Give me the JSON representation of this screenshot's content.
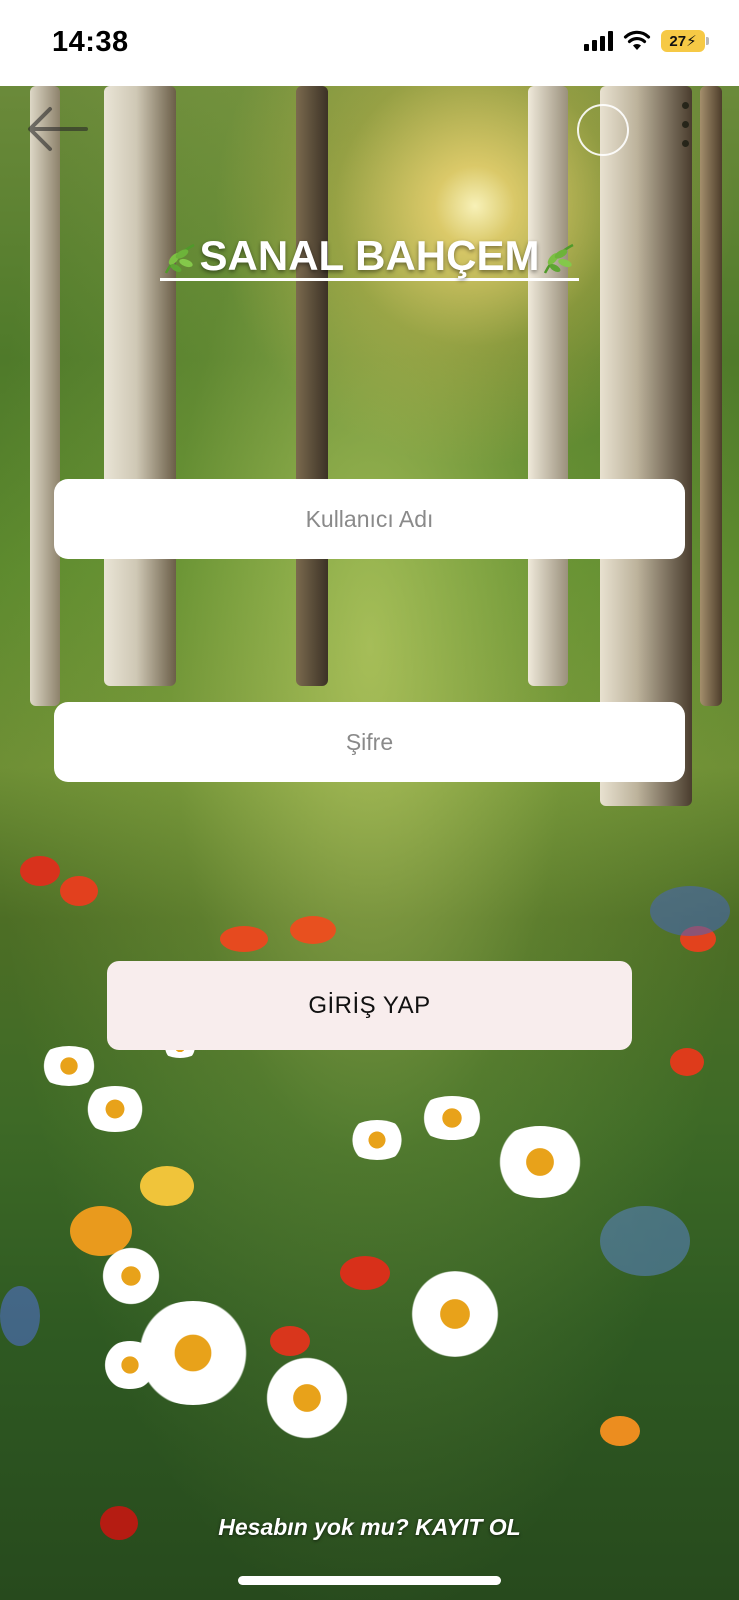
{
  "status_bar": {
    "time": "14:38",
    "battery": "27",
    "icons": [
      "signal-icon",
      "wifi-icon",
      "battery-charging-icon"
    ]
  },
  "nav": {
    "back_icon": "back-arrow-icon",
    "circle_icon": "circle-icon",
    "more_icon": "more-dots-icon"
  },
  "title": "SANAL BAHÇEM",
  "form": {
    "username_placeholder": "Kullanıcı Adı",
    "password_placeholder": "Şifre",
    "login_label": "GİRİŞ YAP"
  },
  "footer": {
    "register_text": "Hesabın yok mu? KAYIT OL"
  },
  "colors": {
    "button_bg": "#f8eded",
    "input_bg": "#ffffff",
    "title_color": "#ffffff",
    "battery": "#f6c945"
  }
}
